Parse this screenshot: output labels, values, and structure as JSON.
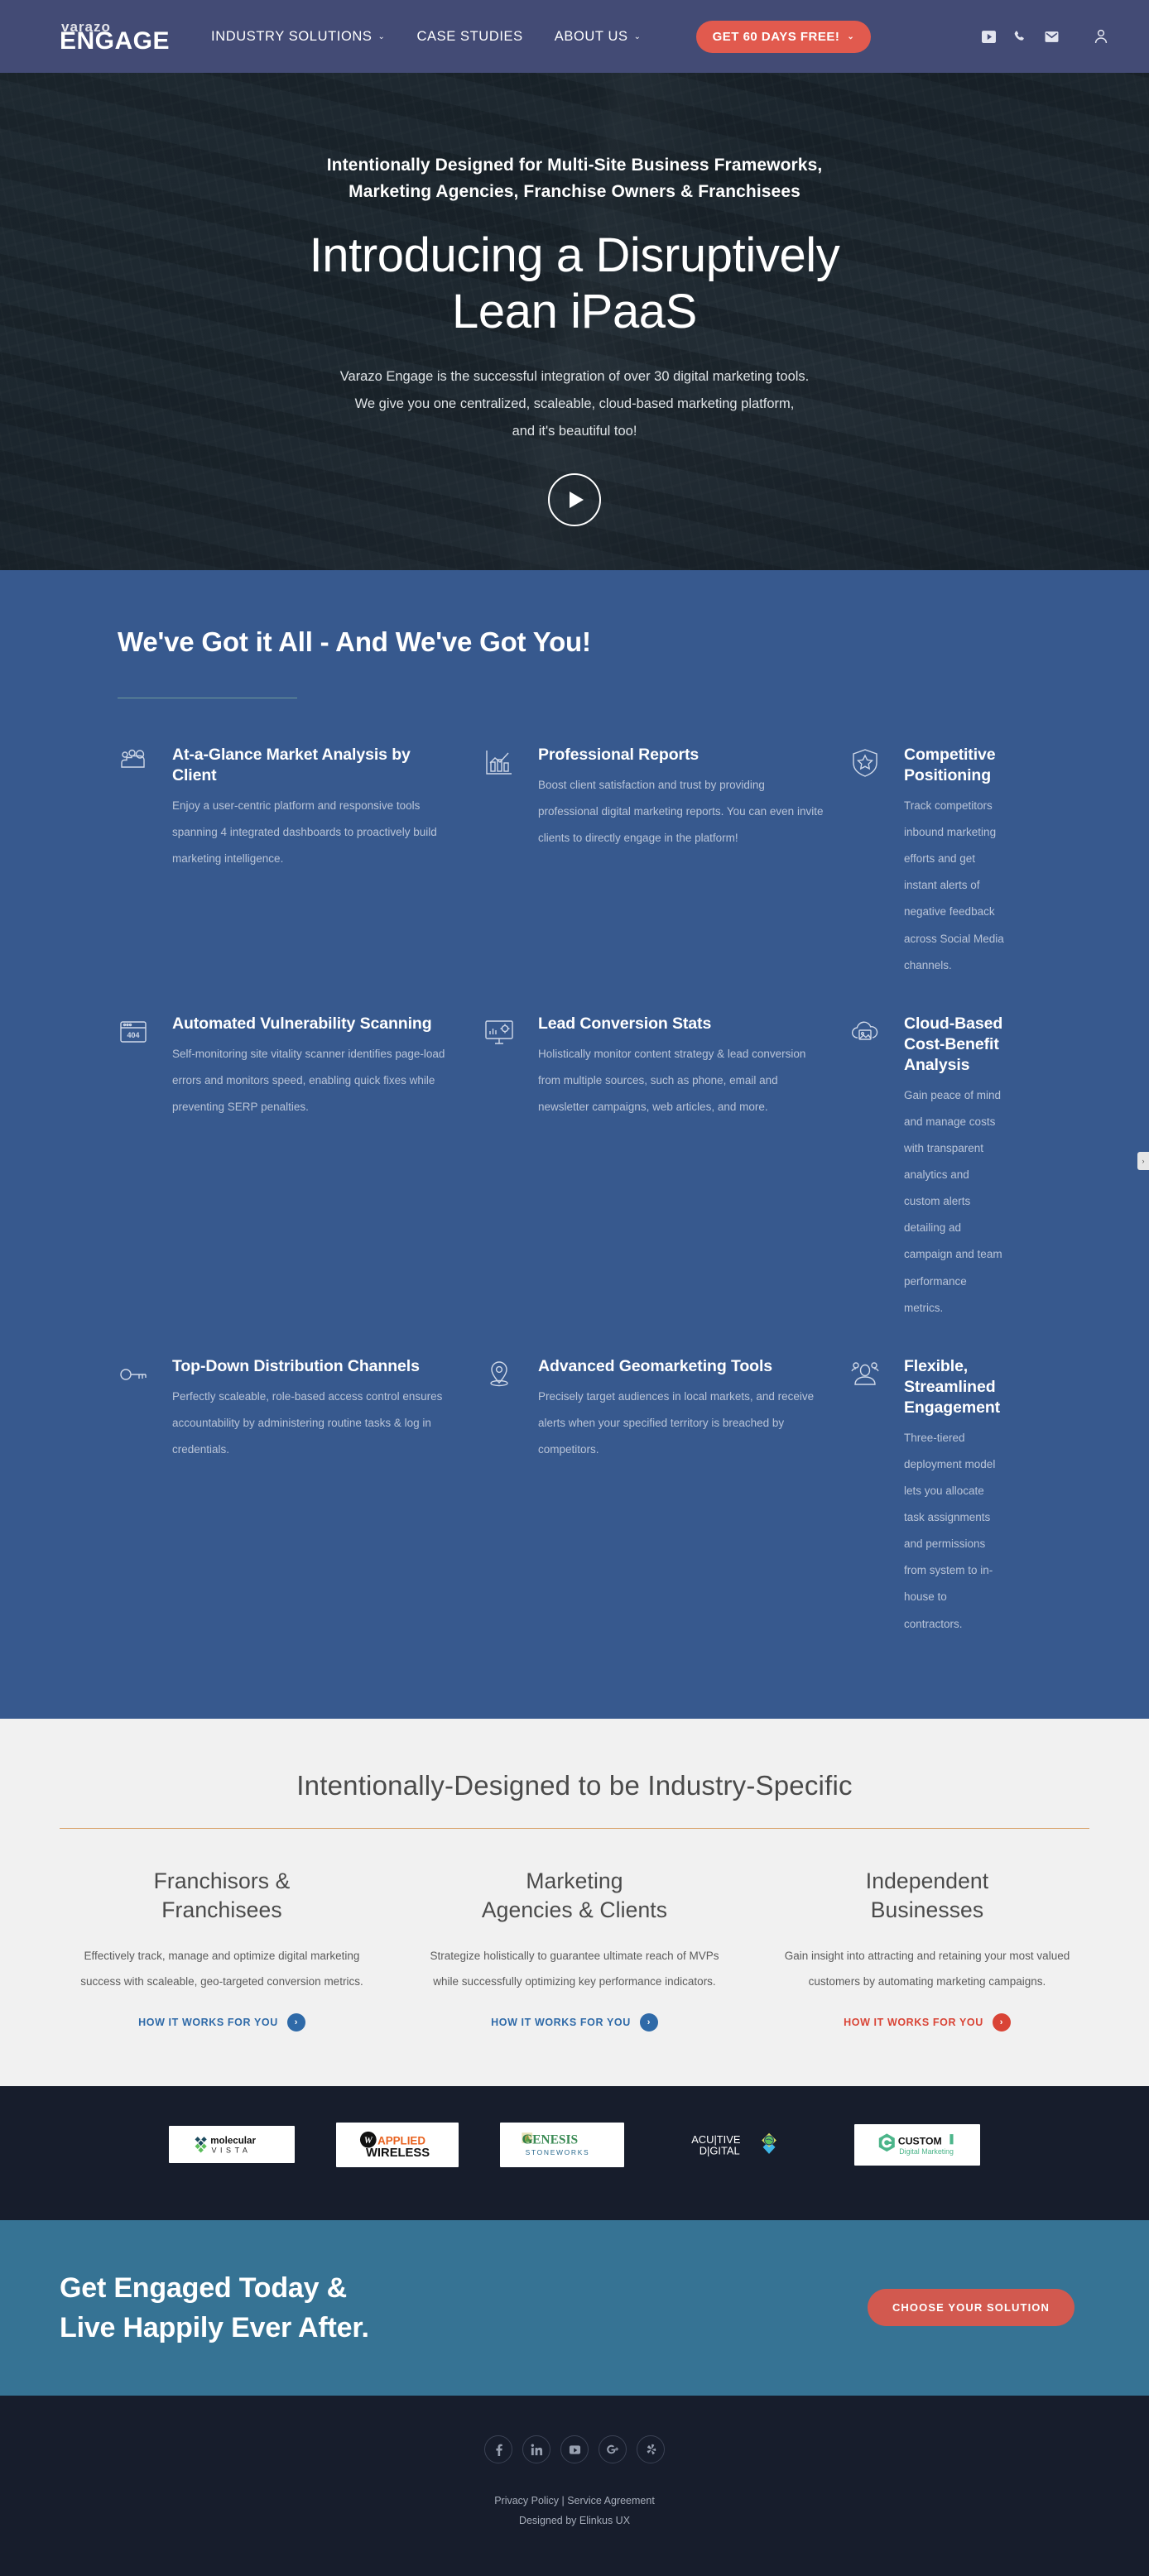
{
  "navbar": {
    "logo_top": "varazo",
    "logo_bottom": "ENGAGE",
    "links": [
      {
        "label": "INDUSTRY SOLUTIONS",
        "caret": "⌄"
      },
      {
        "label": "CASE STUDIES",
        "caret": ""
      },
      {
        "label": "ABOUT US",
        "caret": "⌄"
      }
    ],
    "cta_label": "GET 60 DAYS FREE!",
    "cta_caret": "⌄",
    "cta_color": "#e15a4e",
    "icons": [
      "youtube-icon",
      "phone-icon",
      "mail-icon",
      "user-icon"
    ]
  },
  "hero": {
    "eyebrow_line1": "Intentionally Designed for Multi-Site Business Frameworks,",
    "eyebrow_line2": "Marketing Agencies, Franchise Owners & Franchisees",
    "title_line1": "Introducing a Disruptively",
    "title_line2": "Lean iPaaS",
    "sub_line1": "Varazo Engage is the successful integration of over 30 digital marketing tools.",
    "sub_line2": "We give you one centralized, scaleable, cloud-based marketing platform,",
    "sub_line3": "and it's beautiful too!",
    "play_button": "play-button"
  },
  "features": {
    "title": "We've Got it All - And We've Got You!",
    "background": "#37598e",
    "items": [
      {
        "icon": "people-group-icon",
        "heading": "At-a-Glance Market Analysis by Client",
        "text": "Enjoy a user-centric platform and responsive tools spanning 4 integrated dashboards to proactively build marketing intelligence."
      },
      {
        "icon": "bar-chart-icon",
        "heading": "Professional Reports",
        "text": "Boost client satisfaction and trust by providing professional digital marketing reports. You can even invite clients to directly engage in the platform!"
      },
      {
        "icon": "shield-star-icon",
        "heading": "Competitive Positioning",
        "text": "Track competitors inbound marketing efforts and get instant alerts of negative feedback across Social Media channels."
      },
      {
        "icon": "browser-404-icon",
        "heading": "Automated Vulnerability Scanning",
        "text": "Self-monitoring site vitality scanner identifies page-load errors and monitors speed, enabling quick fixes while preventing SERP penalties."
      },
      {
        "icon": "monitor-analytics-icon",
        "heading": "Lead Conversion Stats",
        "text": "Holistically monitor content strategy & lead conversion from multiple sources, such as phone, email and newsletter campaigns, web articles, and more."
      },
      {
        "icon": "cloud-image-icon",
        "heading": "Cloud-Based Cost-Benefit Analysis",
        "text": "Gain peace of mind and manage costs with transparent analytics and custom alerts detailing ad campaign and team performance metrics."
      },
      {
        "icon": "key-icon",
        "heading": "Top-Down Distribution Channels",
        "text": "Perfectly scaleable, role-based access control ensures accountability by administering routine tasks & log in credentials."
      },
      {
        "icon": "map-pin-icon",
        "heading": "Advanced Geomarketing Tools",
        "text": "Precisely target audiences in local markets, and receive alerts when your specified territory is breached by competitors."
      },
      {
        "icon": "team-person-icon",
        "heading": "Flexible, Streamlined Engagement",
        "text": "Three-tiered deployment model lets you allocate task assignments and permissions from system to in-house to contractors."
      }
    ]
  },
  "industry": {
    "title": "Intentionally-Designed to be Industry-Specific",
    "rule_color": "#d79f63",
    "columns": [
      {
        "heading_line1": "Franchisors &",
        "heading_line2": "Franchisees",
        "text": "Effectively track, manage and optimize digital marketing success with scaleable, geo-targeted conversion metrics.",
        "link_label": "HOW IT WORKS FOR YOU",
        "link_color": "#2f6aa8",
        "arrow": "›"
      },
      {
        "heading_line1": "Marketing",
        "heading_line2": "Agencies & Clients",
        "text": "Strategize holistically to guarantee ultimate reach of MVPs while successfully optimizing key performance indicators.",
        "link_label": "HOW IT WORKS FOR YOU",
        "link_color": "#2f6aa8",
        "arrow": "›"
      },
      {
        "heading_line1": "Independent",
        "heading_line2": "Businesses",
        "text": "Gain insight into attracting and retaining your most valued customers by automating marketing campaigns.",
        "link_label": "HOW IT WORKS FOR YOU",
        "link_color": "#d94436",
        "arrow": "›"
      }
    ]
  },
  "client_logos": [
    {
      "name": "molecular-vista-logo",
      "primary": "molecular",
      "secondary": "V I S T A"
    },
    {
      "name": "applied-wireless-logo",
      "primary": "APPLIED",
      "secondary": "WIRELESS"
    },
    {
      "name": "genesis-stoneworks-logo",
      "primary": "GENESIS",
      "secondary": "STONEWORKS"
    },
    {
      "name": "acuitive-digital-logo",
      "primary": "ACUITIVE",
      "secondary": "DIGITAL"
    },
    {
      "name": "customi-digital-marketing-logo",
      "primary": "CUSTOMi",
      "secondary": "Digital Marketing"
    }
  ],
  "cta_band": {
    "heading_line1": "Get Engaged Today &",
    "heading_line2": "Live Happily Ever After.",
    "button_label": "CHOOSE YOUR SOLUTION",
    "button_color": "#d2594f",
    "background": "#367394"
  },
  "footer": {
    "socials": [
      "facebook-icon",
      "linkedin-icon",
      "youtube-icon",
      "google-plus-icon",
      "yelp-icon"
    ],
    "privacy": "Privacy Policy",
    "separator": " | ",
    "service": "Service Agreement",
    "credit": "Designed by Elinkus UX"
  }
}
